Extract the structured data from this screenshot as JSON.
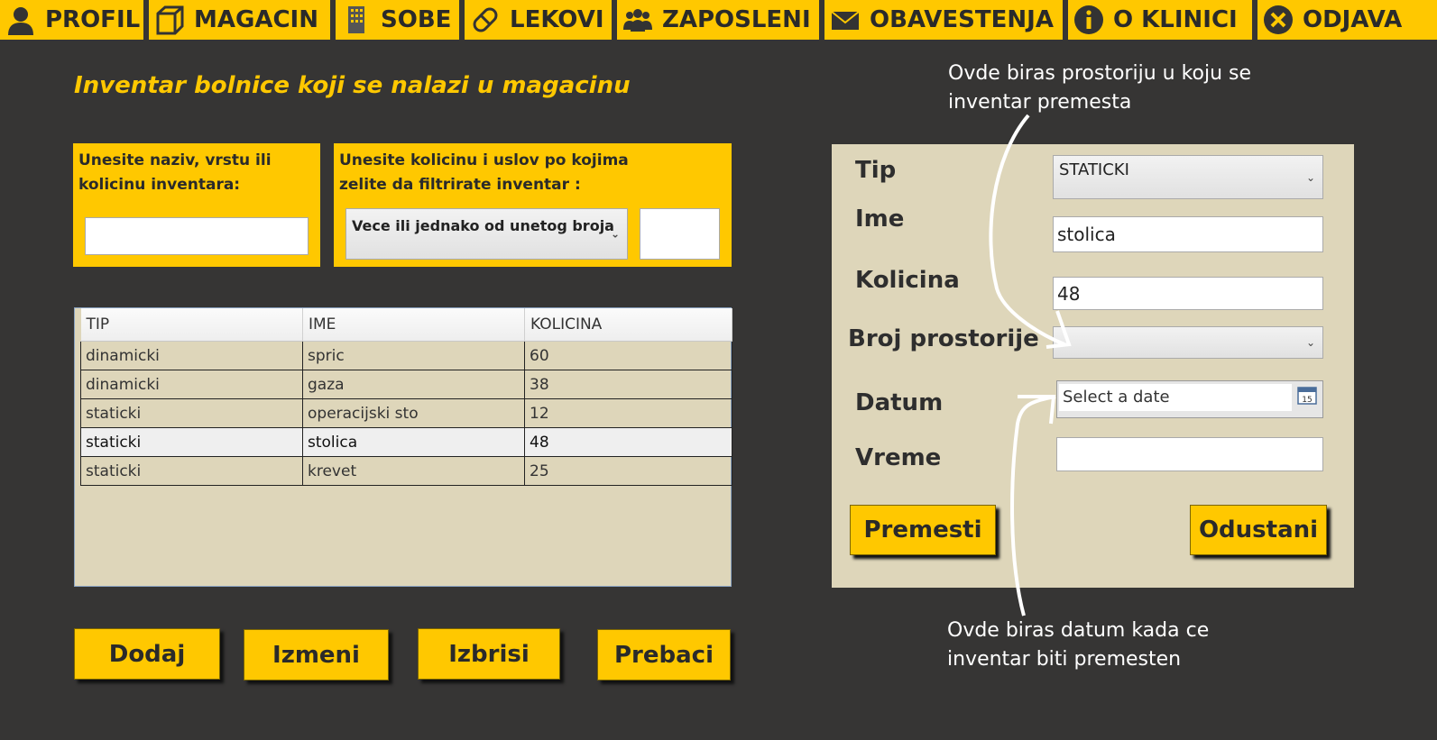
{
  "colors": {
    "accent": "#FFC800",
    "background": "#363534",
    "panel": "#DED6BA"
  },
  "nav": [
    {
      "label": "PROFIL",
      "icon": "user-icon"
    },
    {
      "label": "MAGACIN",
      "icon": "box-icon"
    },
    {
      "label": "SOBE",
      "icon": "building-icon"
    },
    {
      "label": "LEKOVI",
      "icon": "pill-icon"
    },
    {
      "label": "ZAPOSLENI",
      "icon": "group-icon"
    },
    {
      "label": "OBAVESTENJA",
      "icon": "envelope-icon"
    },
    {
      "label": "O KLINICI",
      "icon": "info-icon"
    },
    {
      "label": "ODJAVA",
      "icon": "close-icon"
    }
  ],
  "page_title": "Inventar bolnice koji se nalazi u magacinu",
  "search": {
    "label": "Unesite naziv, vrstu ili\nkolicinu inventara:",
    "value": ""
  },
  "filter": {
    "label": "Unesite kolicinu i uslov po kojima\n zelite da filtrirate inventar :",
    "condition": "Vece ili jednako od unetog broja",
    "amount": ""
  },
  "table": {
    "columns": [
      "TIP",
      "IME",
      "KOLICINA"
    ],
    "rows": [
      {
        "tip": "dinamicki",
        "ime": "spric",
        "kolicina": "60"
      },
      {
        "tip": "dinamicki",
        "ime": "gaza",
        "kolicina": "38"
      },
      {
        "tip": "staticki",
        "ime": "operacijski sto",
        "kolicina": "12"
      },
      {
        "tip": "staticki",
        "ime": "stolica",
        "kolicina": "48"
      },
      {
        "tip": "staticki",
        "ime": "krevet",
        "kolicina": "25"
      }
    ],
    "selected_row": 3
  },
  "buttons": {
    "add": "Dodaj",
    "edit": "Izmeni",
    "delete": "Izbrisi",
    "move": "Prebaci"
  },
  "form": {
    "tip_label": "Tip",
    "tip_value": "STATICKI",
    "ime_label": "Ime",
    "ime_value": "stolica",
    "kolicina_label": "Kolicina",
    "kolicina_value": "48",
    "prostorija_label": "Broj prostorije",
    "prostorija_value": "",
    "datum_label": "Datum",
    "datum_placeholder": "Select a date",
    "vreme_label": "Vreme",
    "vreme_value": "",
    "premesti": "Premesti",
    "odustani": "Odustani"
  },
  "annotations": {
    "room": "Ovde biras prostoriju u koju se\ninventar premesta",
    "date": "Ovde biras datum kada ce\ninventar biti premesten"
  }
}
